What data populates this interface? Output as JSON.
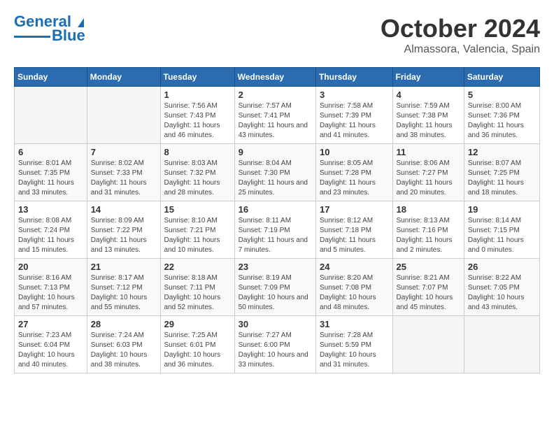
{
  "logo": {
    "line1": "General",
    "line2": "Blue"
  },
  "title": "October 2024",
  "subtitle": "Almassora, Valencia, Spain",
  "headers": [
    "Sunday",
    "Monday",
    "Tuesday",
    "Wednesday",
    "Thursday",
    "Friday",
    "Saturday"
  ],
  "weeks": [
    [
      {
        "day": "",
        "info": ""
      },
      {
        "day": "",
        "info": ""
      },
      {
        "day": "1",
        "info": "Sunrise: 7:56 AM\nSunset: 7:43 PM\nDaylight: 11 hours and 46 minutes."
      },
      {
        "day": "2",
        "info": "Sunrise: 7:57 AM\nSunset: 7:41 PM\nDaylight: 11 hours and 43 minutes."
      },
      {
        "day": "3",
        "info": "Sunrise: 7:58 AM\nSunset: 7:39 PM\nDaylight: 11 hours and 41 minutes."
      },
      {
        "day": "4",
        "info": "Sunrise: 7:59 AM\nSunset: 7:38 PM\nDaylight: 11 hours and 38 minutes."
      },
      {
        "day": "5",
        "info": "Sunrise: 8:00 AM\nSunset: 7:36 PM\nDaylight: 11 hours and 36 minutes."
      }
    ],
    [
      {
        "day": "6",
        "info": "Sunrise: 8:01 AM\nSunset: 7:35 PM\nDaylight: 11 hours and 33 minutes."
      },
      {
        "day": "7",
        "info": "Sunrise: 8:02 AM\nSunset: 7:33 PM\nDaylight: 11 hours and 31 minutes."
      },
      {
        "day": "8",
        "info": "Sunrise: 8:03 AM\nSunset: 7:32 PM\nDaylight: 11 hours and 28 minutes."
      },
      {
        "day": "9",
        "info": "Sunrise: 8:04 AM\nSunset: 7:30 PM\nDaylight: 11 hours and 25 minutes."
      },
      {
        "day": "10",
        "info": "Sunrise: 8:05 AM\nSunset: 7:28 PM\nDaylight: 11 hours and 23 minutes."
      },
      {
        "day": "11",
        "info": "Sunrise: 8:06 AM\nSunset: 7:27 PM\nDaylight: 11 hours and 20 minutes."
      },
      {
        "day": "12",
        "info": "Sunrise: 8:07 AM\nSunset: 7:25 PM\nDaylight: 11 hours and 18 minutes."
      }
    ],
    [
      {
        "day": "13",
        "info": "Sunrise: 8:08 AM\nSunset: 7:24 PM\nDaylight: 11 hours and 15 minutes."
      },
      {
        "day": "14",
        "info": "Sunrise: 8:09 AM\nSunset: 7:22 PM\nDaylight: 11 hours and 13 minutes."
      },
      {
        "day": "15",
        "info": "Sunrise: 8:10 AM\nSunset: 7:21 PM\nDaylight: 11 hours and 10 minutes."
      },
      {
        "day": "16",
        "info": "Sunrise: 8:11 AM\nSunset: 7:19 PM\nDaylight: 11 hours and 7 minutes."
      },
      {
        "day": "17",
        "info": "Sunrise: 8:12 AM\nSunset: 7:18 PM\nDaylight: 11 hours and 5 minutes."
      },
      {
        "day": "18",
        "info": "Sunrise: 8:13 AM\nSunset: 7:16 PM\nDaylight: 11 hours and 2 minutes."
      },
      {
        "day": "19",
        "info": "Sunrise: 8:14 AM\nSunset: 7:15 PM\nDaylight: 11 hours and 0 minutes."
      }
    ],
    [
      {
        "day": "20",
        "info": "Sunrise: 8:16 AM\nSunset: 7:13 PM\nDaylight: 10 hours and 57 minutes."
      },
      {
        "day": "21",
        "info": "Sunrise: 8:17 AM\nSunset: 7:12 PM\nDaylight: 10 hours and 55 minutes."
      },
      {
        "day": "22",
        "info": "Sunrise: 8:18 AM\nSunset: 7:11 PM\nDaylight: 10 hours and 52 minutes."
      },
      {
        "day": "23",
        "info": "Sunrise: 8:19 AM\nSunset: 7:09 PM\nDaylight: 10 hours and 50 minutes."
      },
      {
        "day": "24",
        "info": "Sunrise: 8:20 AM\nSunset: 7:08 PM\nDaylight: 10 hours and 48 minutes."
      },
      {
        "day": "25",
        "info": "Sunrise: 8:21 AM\nSunset: 7:07 PM\nDaylight: 10 hours and 45 minutes."
      },
      {
        "day": "26",
        "info": "Sunrise: 8:22 AM\nSunset: 7:05 PM\nDaylight: 10 hours and 43 minutes."
      }
    ],
    [
      {
        "day": "27",
        "info": "Sunrise: 7:23 AM\nSunset: 6:04 PM\nDaylight: 10 hours and 40 minutes."
      },
      {
        "day": "28",
        "info": "Sunrise: 7:24 AM\nSunset: 6:03 PM\nDaylight: 10 hours and 38 minutes."
      },
      {
        "day": "29",
        "info": "Sunrise: 7:25 AM\nSunset: 6:01 PM\nDaylight: 10 hours and 36 minutes."
      },
      {
        "day": "30",
        "info": "Sunrise: 7:27 AM\nSunset: 6:00 PM\nDaylight: 10 hours and 33 minutes."
      },
      {
        "day": "31",
        "info": "Sunrise: 7:28 AM\nSunset: 5:59 PM\nDaylight: 10 hours and 31 minutes."
      },
      {
        "day": "",
        "info": ""
      },
      {
        "day": "",
        "info": ""
      }
    ]
  ]
}
